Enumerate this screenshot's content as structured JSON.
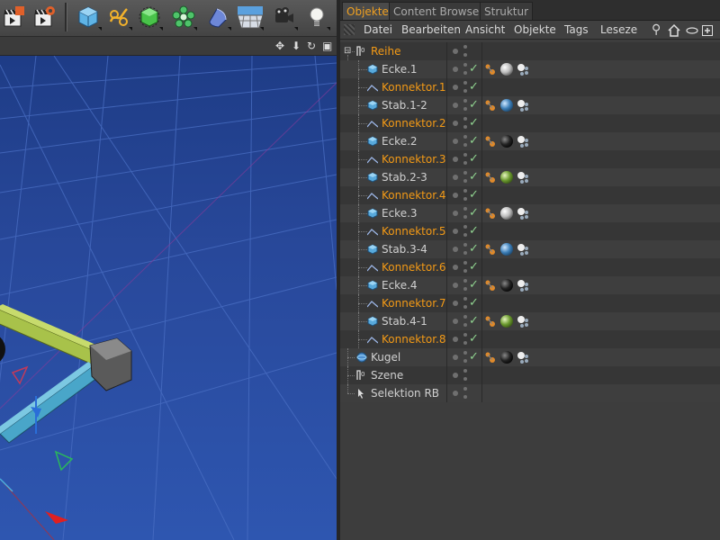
{
  "colors": {
    "selected_text": "#f39a16",
    "viewport_top": "#1e3c86",
    "viewport_bottom": "#2e56b0",
    "check": "#8fd18f"
  },
  "toolbar": {
    "icons": [
      "render-view-icon",
      "render-settings-icon",
      "cube-icon",
      "spline-icon",
      "generator-icon",
      "array-icon",
      "deformer-icon",
      "floor-icon",
      "camera-icon",
      "light-icon"
    ]
  },
  "viewport_header": {
    "icons": [
      "move-view-icon",
      "down-arrow-icon",
      "rotate-view-icon",
      "maximize-icon"
    ]
  },
  "tabs": [
    {
      "label": "Objekte",
      "active": true
    },
    {
      "label": "Content Browser",
      "active": false
    },
    {
      "label": "Struktur",
      "active": false
    }
  ],
  "menu": [
    "Datei",
    "Bearbeiten",
    "Ansicht",
    "Objekte",
    "Tags",
    "Leseze"
  ],
  "menu_icons": [
    "search-icon",
    "home-icon",
    "eye-icon",
    "new-view-icon"
  ],
  "objects": [
    {
      "name": "Reihe",
      "selected": true,
      "icon": "null-icon",
      "indent": 0,
      "tags": []
    },
    {
      "name": "Ecke.1",
      "selected": false,
      "icon": "cube-icon",
      "indent": 1,
      "tags": [
        "white"
      ]
    },
    {
      "name": "Konnektor.1",
      "selected": true,
      "icon": "connector-icon",
      "indent": 1,
      "tags": []
    },
    {
      "name": "Stab.1-2",
      "selected": false,
      "icon": "cube-icon",
      "indent": 1,
      "tags": [
        "blue"
      ]
    },
    {
      "name": "Konnektor.2",
      "selected": true,
      "icon": "connector-icon",
      "indent": 1,
      "tags": []
    },
    {
      "name": "Ecke.2",
      "selected": false,
      "icon": "cube-icon",
      "indent": 1,
      "tags": [
        "black"
      ]
    },
    {
      "name": "Konnektor.3",
      "selected": true,
      "icon": "connector-icon",
      "indent": 1,
      "tags": []
    },
    {
      "name": "Stab.2-3",
      "selected": false,
      "icon": "cube-icon",
      "indent": 1,
      "tags": [
        "green"
      ]
    },
    {
      "name": "Konnektor.4",
      "selected": true,
      "icon": "connector-icon",
      "indent": 1,
      "tags": []
    },
    {
      "name": "Ecke.3",
      "selected": false,
      "icon": "cube-icon",
      "indent": 1,
      "tags": [
        "white"
      ]
    },
    {
      "name": "Konnektor.5",
      "selected": true,
      "icon": "connector-icon",
      "indent": 1,
      "tags": []
    },
    {
      "name": "Stab.3-4",
      "selected": false,
      "icon": "cube-icon",
      "indent": 1,
      "tags": [
        "blue"
      ]
    },
    {
      "name": "Konnektor.6",
      "selected": true,
      "icon": "connector-icon",
      "indent": 1,
      "tags": []
    },
    {
      "name": "Ecke.4",
      "selected": false,
      "icon": "cube-icon",
      "indent": 1,
      "tags": [
        "black"
      ]
    },
    {
      "name": "Konnektor.7",
      "selected": true,
      "icon": "connector-icon",
      "indent": 1,
      "tags": []
    },
    {
      "name": "Stab.4-1",
      "selected": false,
      "icon": "cube-icon",
      "indent": 1,
      "tags": [
        "green"
      ]
    },
    {
      "name": "Konnektor.8",
      "selected": true,
      "icon": "connector-icon",
      "indent": 1,
      "tags": []
    },
    {
      "name": "Kugel",
      "selected": false,
      "icon": "sphere-icon",
      "indent": 0,
      "tags": [
        "black"
      ]
    },
    {
      "name": "Szene",
      "selected": false,
      "icon": "null-icon",
      "indent": 0,
      "tags": []
    },
    {
      "name": "Selektion RB",
      "selected": false,
      "icon": "selection-icon",
      "indent": 0,
      "tags": []
    }
  ]
}
